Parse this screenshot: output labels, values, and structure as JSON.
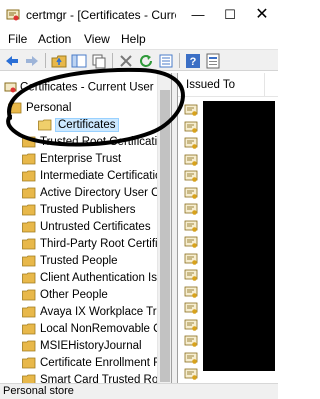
{
  "window": {
    "title": "certmgr - [Certificates - Current User\\Personal\\Certificates]",
    "minimize_glyph": "—",
    "maximize_glyph": "☐",
    "close_glyph": "✕"
  },
  "menu": {
    "items": [
      {
        "label": "File"
      },
      {
        "label": "Action"
      },
      {
        "label": "View"
      },
      {
        "label": "Help"
      }
    ]
  },
  "tree": {
    "root_label": "Certificates - Current User",
    "items": [
      {
        "label": "Personal"
      },
      {
        "label": "Certificates",
        "selected": true
      },
      {
        "label": "Trusted Root Certification Authorities"
      },
      {
        "label": "Enterprise Trust"
      },
      {
        "label": "Intermediate Certification Authorities"
      },
      {
        "label": "Active Directory User Object"
      },
      {
        "label": "Trusted Publishers"
      },
      {
        "label": "Untrusted Certificates"
      },
      {
        "label": "Third-Party Root Certification Authorities"
      },
      {
        "label": "Trusted People"
      },
      {
        "label": "Client Authentication Issuers"
      },
      {
        "label": "Other People"
      },
      {
        "label": "Avaya IX Workplace Trust"
      },
      {
        "label": "Local NonRemovable Certificates"
      },
      {
        "label": "MSIEHistoryJournal"
      },
      {
        "label": "Certificate Enrollment Requests"
      },
      {
        "label": "Smart Card Trusted Roots"
      }
    ]
  },
  "list": {
    "column_header": "Issued To",
    "row_count": 17
  },
  "status": {
    "text": "Personal store"
  },
  "colors": {
    "folder": "#e8b84a",
    "selection": "#cce8ff",
    "annotation": "#000000"
  }
}
